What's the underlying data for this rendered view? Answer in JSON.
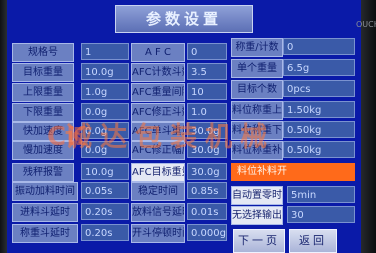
{
  "screen_title": "参数设置",
  "bezel_text": "OUCH",
  "watermark": "诚达包装机械",
  "rows": [
    {
      "label": "规格号",
      "value": "1"
    },
    {
      "label": "目标重量",
      "value": "10.0g"
    },
    {
      "label": "上限重量",
      "value": "1.0g"
    },
    {
      "label": "下限重量",
      "value": "0.0g"
    },
    {
      "label": "快加速度",
      "value": "0.0g"
    },
    {
      "label": "慢加速度",
      "value": "0.0g"
    },
    {
      "label": "残秤报警",
      "value": "10.0g"
    },
    {
      "label": "振动加料时间",
      "value": "0.05s"
    },
    {
      "label": "进料斗延时",
      "value": "0.20s"
    },
    {
      "label": "称重斗延时",
      "value": "0.20s"
    }
  ],
  "afc": [
    {
      "label": "A F C",
      "value": "0"
    },
    {
      "label": "AFC计数斗数",
      "value": "3.5"
    },
    {
      "label": "AFC重量间隔",
      "value": "10"
    },
    {
      "label": "AFC修正斗数",
      "value": "1.0"
    },
    {
      "label": "AFC单斗重量",
      "value": "30.0g"
    },
    {
      "label": "AFC修正幅度",
      "value": "30.0g"
    },
    {
      "label": "AFC目标重量",
      "value": "30.0g"
    },
    {
      "label": "稳定时间",
      "value": "0.85s"
    },
    {
      "label": "放料信号延时",
      "value": "0.01s"
    },
    {
      "label": "开斗停顿时间",
      "value": "0.000g"
    }
  ],
  "right": [
    {
      "label": "称重/计数",
      "value": "0"
    },
    {
      "label": "单个重量",
      "value": "6.5g"
    },
    {
      "label": "目标个数",
      "value": "0pcs"
    },
    {
      "label": "料位称重上限",
      "value": "1.50kg"
    },
    {
      "label": "料位称重下限",
      "value": "0.50kg"
    },
    {
      "label": "料位称重补料",
      "value": "0.50kg"
    }
  ],
  "alarm_text": "料位补料开",
  "auto_zero_label": "自动置零时间",
  "auto_zero_value": "5min",
  "no_select_label": "无选择输出",
  "no_select_value": "30",
  "prev_page": "下一页",
  "back": "返回",
  "colors": {
    "screen_bg": "#0a1aa8",
    "alarm": "#ff6a1a"
  }
}
